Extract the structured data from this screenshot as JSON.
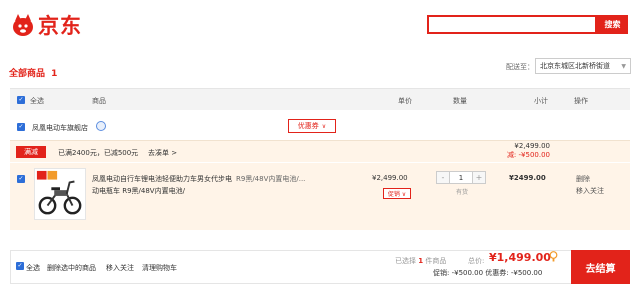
{
  "header": {
    "logo_text": "京东",
    "search_button": "搜索",
    "search_value": ""
  },
  "cart": {
    "all_goods_label": "全部商品",
    "all_goods_count": "1",
    "ship_to_label": "配送至：",
    "ship_to_value": "北京东城区北新桥街道"
  },
  "table_header": {
    "select_all": "全选",
    "product": "商品",
    "unit_price": "单价",
    "quantity": "数量",
    "subtotal": "小计",
    "actions": "操作"
  },
  "shop": {
    "name": "凤凰电动车旗舰店",
    "coupon_label": "优惠券",
    "coupon_caret": "∨"
  },
  "promo": {
    "tag": "满减",
    "text": "已满2400元，已减500元",
    "link": "去凑单 >",
    "group_total": "¥2,499.00",
    "group_discount": "减: -¥500.00"
  },
  "item": {
    "title": "凤凰电动自行车锂电池轻便助力车男女代步电动电瓶车 R9黑/48V内置电池/",
    "spec": "R9黑/48V内置电池/...",
    "price": "¥2,499.00",
    "price_drop_label": "促销 ∨",
    "quantity": "1",
    "qty_minus": "-",
    "qty_plus": "+",
    "stock_status": "有货",
    "subtotal": "¥2499.00",
    "delete": "删除",
    "move_to_favorites": "移入关注"
  },
  "footer": {
    "select_all": "全选",
    "delete_selected": "删除选中的商品",
    "move_to_favorites": "移入关注",
    "clear_cart": "清理购物车",
    "selected_prefix": "已选择",
    "selected_count": "1",
    "selected_suffix": "件商品",
    "total_label": "总价:",
    "total_value": "¥1,499.00",
    "promo_summary": "促销: -¥500.00  优惠券: -¥500.00",
    "settle_button": "去结算"
  },
  "colors": {
    "brand_red": "#e2231a",
    "checkbox_blue": "#2d6ed8",
    "promo_band": "#fff4e8"
  }
}
